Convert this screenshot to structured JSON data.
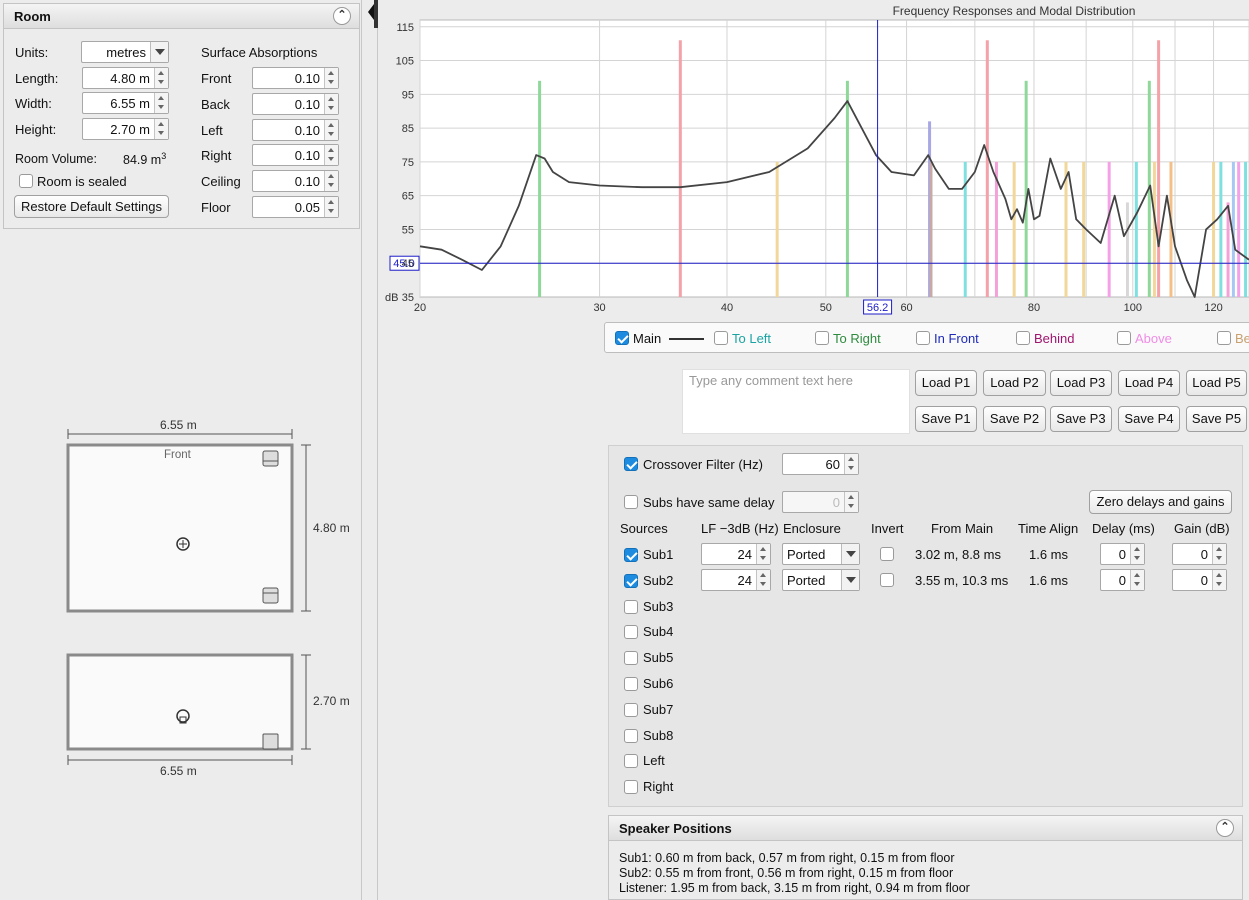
{
  "room": {
    "title": "Room",
    "units_label": "Units:",
    "units_value": "metres",
    "length_label": "Length:",
    "length_value": "4.80 m",
    "width_label": "Width:",
    "width_value": "6.55 m",
    "height_label": "Height:",
    "height_value": "2.70 m",
    "volume_label": "Room Volume:",
    "volume_value": "84.9 m",
    "volume_unit_sup": "3",
    "sealed_label": "Room is sealed",
    "sealed_checked": false,
    "restore_label": "Restore Default Settings",
    "absorptions_title": "Surface Absorptions",
    "absorptions": [
      {
        "label": "Front",
        "value": "0.10"
      },
      {
        "label": "Back",
        "value": "0.10"
      },
      {
        "label": "Left",
        "value": "0.10"
      },
      {
        "label": "Right",
        "value": "0.10"
      },
      {
        "label": "Ceiling",
        "value": "0.10"
      },
      {
        "label": "Floor",
        "value": "0.05"
      }
    ]
  },
  "plan": {
    "top_width_label": "6.55 m",
    "front_label": "Front",
    "length_label": "4.80 m",
    "elev_height_label": "2.70 m",
    "elev_width_label": "6.55 m"
  },
  "chart_data": {
    "type": "line",
    "title": "Frequency Responses and Modal Distribution",
    "ylabel": "dB",
    "x_scale": "log",
    "xlim": [
      20,
      130
    ],
    "ylim": [
      35,
      117
    ],
    "x_ticks": [
      20,
      30,
      40,
      50,
      60,
      80,
      100,
      120
    ],
    "y_ticks": [
      35,
      45,
      55,
      65,
      75,
      85,
      95,
      105,
      115
    ],
    "grid": true,
    "cursor": {
      "x": 56.2,
      "y": 45.0,
      "x_label": "56.2",
      "y_label": "45.0"
    },
    "series": [
      {
        "name": "Main",
        "color": "#444444",
        "points": [
          [
            20,
            50
          ],
          [
            21,
            49
          ],
          [
            22,
            46
          ],
          [
            23,
            43
          ],
          [
            24,
            50
          ],
          [
            25,
            62
          ],
          [
            26,
            77
          ],
          [
            26.5,
            76
          ],
          [
            27,
            72
          ],
          [
            28,
            69
          ],
          [
            30,
            68
          ],
          [
            33,
            67.5
          ],
          [
            36,
            67.5
          ],
          [
            40,
            69
          ],
          [
            44,
            72
          ],
          [
            48,
            79
          ],
          [
            51,
            88
          ],
          [
            52.5,
            93
          ],
          [
            54,
            86
          ],
          [
            56,
            77
          ],
          [
            58,
            72
          ],
          [
            61,
            71
          ],
          [
            63,
            77
          ],
          [
            64,
            73
          ],
          [
            66,
            67
          ],
          [
            68,
            67
          ],
          [
            70,
            72
          ],
          [
            71.5,
            80
          ],
          [
            73,
            72
          ],
          [
            75,
            64
          ],
          [
            76,
            58
          ],
          [
            77,
            61
          ],
          [
            78,
            57
          ],
          [
            79,
            67
          ],
          [
            80,
            58
          ],
          [
            81,
            59
          ],
          [
            83,
            76
          ],
          [
            85,
            67
          ],
          [
            86.5,
            72
          ],
          [
            88,
            58
          ],
          [
            90,
            55
          ],
          [
            93,
            51
          ],
          [
            96,
            65
          ],
          [
            98,
            53
          ],
          [
            101,
            60
          ],
          [
            104,
            68
          ],
          [
            106,
            50
          ],
          [
            108,
            65
          ],
          [
            110,
            50
          ],
          [
            113,
            40
          ],
          [
            115,
            32
          ],
          [
            118,
            55
          ],
          [
            121,
            58
          ],
          [
            124,
            62
          ],
          [
            126,
            49
          ],
          [
            130,
            46
          ]
        ]
      }
    ],
    "modes": [
      {
        "f": 26.2,
        "level": 99,
        "color": "#8fd89a"
      },
      {
        "f": 36.0,
        "level": 111,
        "color": "#f4a1a8"
      },
      {
        "f": 44.8,
        "level": 75,
        "color": "#f1d79a"
      },
      {
        "f": 52.5,
        "level": 99,
        "color": "#8fd89a"
      },
      {
        "f": 63.2,
        "level": 87,
        "color": "#a8a8e4"
      },
      {
        "f": 63.4,
        "level": 75,
        "color": "#c9a8a8"
      },
      {
        "f": 68.5,
        "level": 75,
        "color": "#7fe0e0"
      },
      {
        "f": 72.0,
        "level": 111,
        "color": "#f4a1a8"
      },
      {
        "f": 73.5,
        "level": 75,
        "color": "#f4a1d8"
      },
      {
        "f": 76.5,
        "level": 75,
        "color": "#f1d79a"
      },
      {
        "f": 78.6,
        "level": 99,
        "color": "#8fd89a"
      },
      {
        "f": 86.0,
        "level": 75,
        "color": "#f1d79a"
      },
      {
        "f": 89.5,
        "level": 75,
        "color": "#f1d79a"
      },
      {
        "f": 94.8,
        "level": 75,
        "color": "#f4a1e8"
      },
      {
        "f": 98.8,
        "level": 63,
        "color": "#d8d8d8"
      },
      {
        "f": 100.8,
        "level": 75,
        "color": "#7fe0e0"
      },
      {
        "f": 103.8,
        "level": 99,
        "color": "#8fd89a"
      },
      {
        "f": 105.0,
        "level": 75,
        "color": "#f1d79a"
      },
      {
        "f": 106.0,
        "level": 111,
        "color": "#f4a1a8"
      },
      {
        "f": 109.0,
        "level": 75,
        "color": "#f4c08a"
      },
      {
        "f": 120.0,
        "level": 75,
        "color": "#f1d79a"
      },
      {
        "f": 122.0,
        "level": 75,
        "color": "#7fe0e0"
      },
      {
        "f": 124.0,
        "level": 63,
        "color": "#f4a1d8"
      },
      {
        "f": 125.5,
        "level": 75,
        "color": "#a8c8f4"
      },
      {
        "f": 127.0,
        "level": 75,
        "color": "#f4a1e8"
      },
      {
        "f": 129.0,
        "level": 75,
        "color": "#7fe0e0"
      }
    ]
  },
  "legend": [
    {
      "label": "Main",
      "checked": true,
      "color": "#111111",
      "line": true
    },
    {
      "label": "To Left",
      "checked": false,
      "color": "#1aa3a3"
    },
    {
      "label": "To Right",
      "checked": false,
      "color": "#2e8b3e"
    },
    {
      "label": "In Front",
      "checked": false,
      "color": "#1d2bb8"
    },
    {
      "label": "Behind",
      "checked": false,
      "color": "#a0146e"
    },
    {
      "label": "Above",
      "checked": false,
      "color": "#f08ce6"
    },
    {
      "label": "Be",
      "checked": false,
      "color": "#c8a070"
    }
  ],
  "comment_placeholder": "Type any comment text here",
  "presets": {
    "load": [
      "Load P1",
      "Load P2",
      "Load P3",
      "Load P4",
      "Load P5"
    ],
    "save": [
      "Save P1",
      "Save P2",
      "Save P3",
      "Save P4",
      "Save P5"
    ]
  },
  "subs": {
    "crossover_label": "Crossover Filter (Hz)",
    "crossover_checked": true,
    "crossover_value": "60",
    "same_delay_label": "Subs have same delay",
    "same_delay_checked": false,
    "same_delay_value": "0",
    "zero_button": "Zero delays and gains",
    "headers": [
      "Sources",
      "LF −3dB (Hz)",
      "Enclosure",
      "Invert",
      "From Main",
      "Time Align",
      "Delay (ms)",
      "Gain (dB)"
    ],
    "rows": [
      {
        "name": "Sub1",
        "checked": true,
        "lf": "24",
        "enclosure": "Ported",
        "invert": false,
        "from_main": "3.02 m, 8.8 ms",
        "time_align": "1.6 ms",
        "delay": "0",
        "gain": "0"
      },
      {
        "name": "Sub2",
        "checked": true,
        "lf": "24",
        "enclosure": "Ported",
        "invert": false,
        "from_main": "3.55 m, 10.3 ms",
        "time_align": "1.6 ms",
        "delay": "0",
        "gain": "0"
      },
      {
        "name": "Sub3",
        "checked": false
      },
      {
        "name": "Sub4",
        "checked": false
      },
      {
        "name": "Sub5",
        "checked": false
      },
      {
        "name": "Sub6",
        "checked": false
      },
      {
        "name": "Sub7",
        "checked": false
      },
      {
        "name": "Sub8",
        "checked": false
      },
      {
        "name": "Left",
        "checked": false
      },
      {
        "name": "Right",
        "checked": false
      }
    ]
  },
  "positions": {
    "title": "Speaker Positions",
    "lines": [
      "Sub1: 0.60 m from back, 0.57 m from right, 0.15 m from floor",
      "Sub2: 0.55 m from front, 0.56 m from right, 0.15 m from floor",
      "Listener: 1.95 m from back, 3.15 m from right, 0.94 m from floor"
    ]
  }
}
